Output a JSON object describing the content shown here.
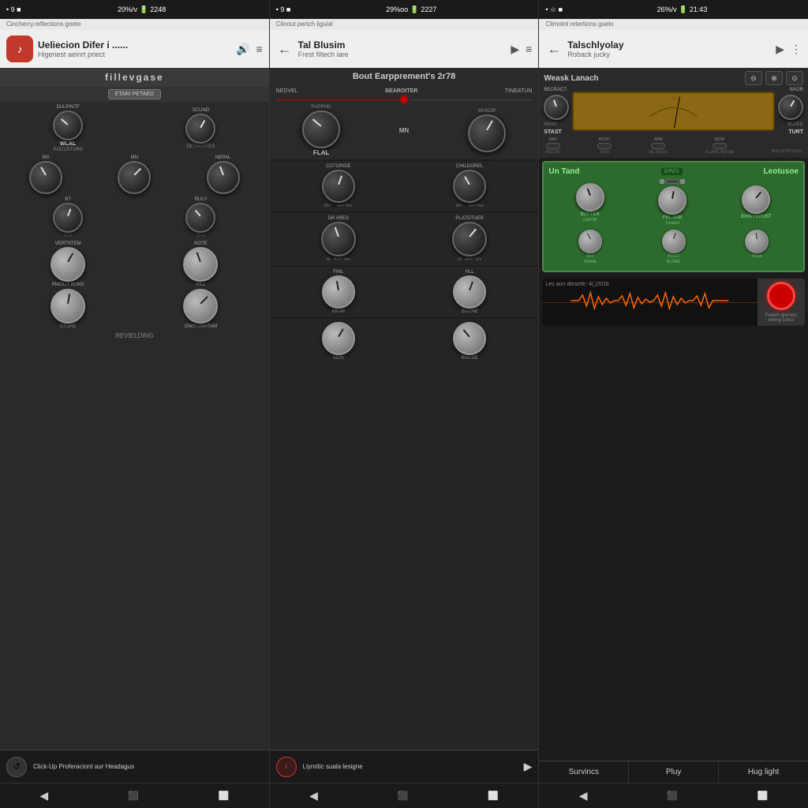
{
  "status_bars": [
    {
      "left": "• 9 ■",
      "center": "20%/v  2248",
      "right": ""
    },
    {
      "left": "• 9 ■",
      "center": "29%oo  2227",
      "right": ""
    },
    {
      "left": "• ☆ ■",
      "center": "26%/v  21:43",
      "right": ""
    }
  ],
  "panels": [
    {
      "id": "panel1",
      "app_bar_text": "Cincherry.reflections gnete",
      "header": {
        "icon": "♪",
        "title": "Ueliecion Difer i ......",
        "subtitle": "Higenest aeinrt priect",
        "icons": [
          "🔊",
          "≡"
        ]
      },
      "plugin_name": "fillevgase",
      "plugin_mode": "ETARI PETAED",
      "knob_rows": [
        {
          "labels_top": [
            "DULPINTF",
            "",
            "SCUND"
          ],
          "knobs": [
            {
              "size": "normal",
              "rotation": "-60deg",
              "label": "WLAL",
              "sublabel": ""
            },
            {
              "size": "normal",
              "rotation": "30deg",
              "label": "",
              "sublabel": ""
            }
          ],
          "labels_bottom": [
            "POCUSTURE",
            "",
            "DETANSTES"
          ]
        },
        {
          "labels_top": [
            "MX",
            "MN",
            "NEPAL"
          ],
          "knobs": [
            {
              "size": "normal",
              "rotation": "-30deg"
            },
            {
              "size": "normal",
              "rotation": "45deg"
            },
            {
              "size": "normal",
              "rotation": "-20deg"
            }
          ]
        },
        {
          "labels_top": [
            "BT",
            "",
            "RULY"
          ],
          "knobs": [
            {
              "size": "normal",
              "rotation": "20deg"
            },
            {
              "size": "normal",
              "rotation": "-40deg"
            }
          ],
          "labels_bottom": [
            "",
            "3lmt",
            ""
          ]
        },
        {
          "labels_top": [
            "VERTNTEM",
            "",
            "NOTE"
          ],
          "knobs": [
            {
              "size": "silver",
              "rotation": "30deg",
              "label": "RMOLIT BUNX"
            },
            {
              "size": "silver",
              "rotation": "-20deg",
              "label": "HILL"
            }
          ]
        },
        {
          "labels_top": [
            "",
            "",
            ""
          ],
          "knobs": [
            {
              "size": "silver",
              "rotation": "10deg",
              "label": "STORE"
            },
            {
              "size": "silver",
              "rotation": "45deg",
              "label": "ONIS USHTAM"
            }
          ]
        }
      ],
      "section_label": "REVIELDING",
      "bottom_bar": {
        "icon": "↺",
        "text": "Click-Up Proferaciont aur Headagus",
        "play": ""
      }
    },
    {
      "id": "panel2",
      "app_bar_text": "Clinout pertch liguial",
      "header": {
        "back": "←",
        "title": "Tal Blusim",
        "subtitle": "Frest filtech iare",
        "icons": [
          "▶",
          "≡"
        ]
      },
      "plugin_title": "Bout Earpprement's 2r78",
      "sections": [
        {
          "name": "BEAROITER",
          "left_label": "NEDVEL",
          "right_label": "TINEATUN",
          "knobs": [
            {
              "size": "large",
              "rotation": "-50deg",
              "label": "FLAL",
              "sublabel": ""
            },
            {
              "size": "large",
              "rotation": "30deg",
              "label": "",
              "sublabel": ""
            }
          ],
          "bottom_labels": [
            "PUPPHG",
            "MN",
            "MUNDR"
          ]
        },
        {
          "name": "",
          "left_label": "COTORIDE",
          "right_label": "CHILDOREL",
          "knobs": [
            {
              "size": "normal",
              "rotation": "20deg",
              "bottom": "6mt Tars"
            },
            {
              "size": "normal",
              "rotation": "-30deg",
              "bottom": "6mt Tars"
            }
          ]
        },
        {
          "left_label": "DR IIRES",
          "right_label": "PLATOTUER",
          "knobs": [
            {
              "size": "normal",
              "rotation": "-20deg",
              "bottom": "Armt Tars"
            },
            {
              "size": "normal",
              "rotation": "40deg",
              "bottom": "Armt Tars"
            }
          ]
        },
        {
          "left_group": {
            "top": "FINL",
            "knob_r": "-10deg",
            "bottom": "MIUM"
          },
          "right_group": {
            "top": "HLL",
            "knob_r": "20deg",
            "bottom": "SCONE"
          }
        },
        {
          "left_group": {
            "top": "",
            "knob_r": "30deg",
            "bottom": "VERI"
          },
          "right_group": {
            "top": "",
            "knob_r": "-40deg",
            "bottom": "RNUSE"
          }
        }
      ],
      "bottom_bar": {
        "icon": "♪",
        "icon_color": "#cc3333",
        "text": "Llynritic suala lesigne",
        "play": "▶"
      }
    },
    {
      "id": "panel3",
      "app_bar_text": "Climoint retertions guelo",
      "header": {
        "back": "←",
        "title": "Talschlyolay",
        "subtitle": "Roback jucky",
        "icons": [
          "▶",
          "⋮"
        ]
      },
      "plugin_title": "Weask Lanach",
      "controls": {
        "left_knobs": [
          "BECRACT",
          "STAST"
        ],
        "vu_label": "",
        "right_knobs": [
          "BAOR",
          "TURT"
        ],
        "toggles": [
          {
            "label": "OAY",
            "type": "switch"
          },
          {
            "label": "RICBT",
            "type": "switch"
          },
          {
            "label": "ARM",
            "type": "switch"
          },
          {
            "label": "NOW",
            "type": "switch"
          }
        ],
        "bottom_toggles": [
          "POLITG",
          "TWN",
          "ML ENOIC",
          "FLUPAL BUTER",
          "BOLUX POYLES"
        ]
      },
      "green_plugin": {
        "title_left": "Un Tand",
        "title_right": "Leotusoe",
        "knob_rows": [
          {
            "knobs": 4
          }
        ],
        "labels": [
          "BUTTER",
          "CAFOR",
          "PEL DAK Context",
          "EHINYEPUST"
        ],
        "bottom_labels": [
          "Ano",
          "BOUD",
          "Plabe",
          "SMAAL",
          "AUSME"
        ]
      },
      "waveform": {
        "label": "Les aun denorte: 4(,)2016",
        "has_record_btn": true
      },
      "bottom_text": {
        "left": "Foeleh glemics worng cohor"
      },
      "tabs": [
        "Survincs",
        "Pluy",
        "Hug light"
      ]
    }
  ],
  "nav": {
    "back": "◀",
    "home": "⬛",
    "recent": "⬜"
  }
}
